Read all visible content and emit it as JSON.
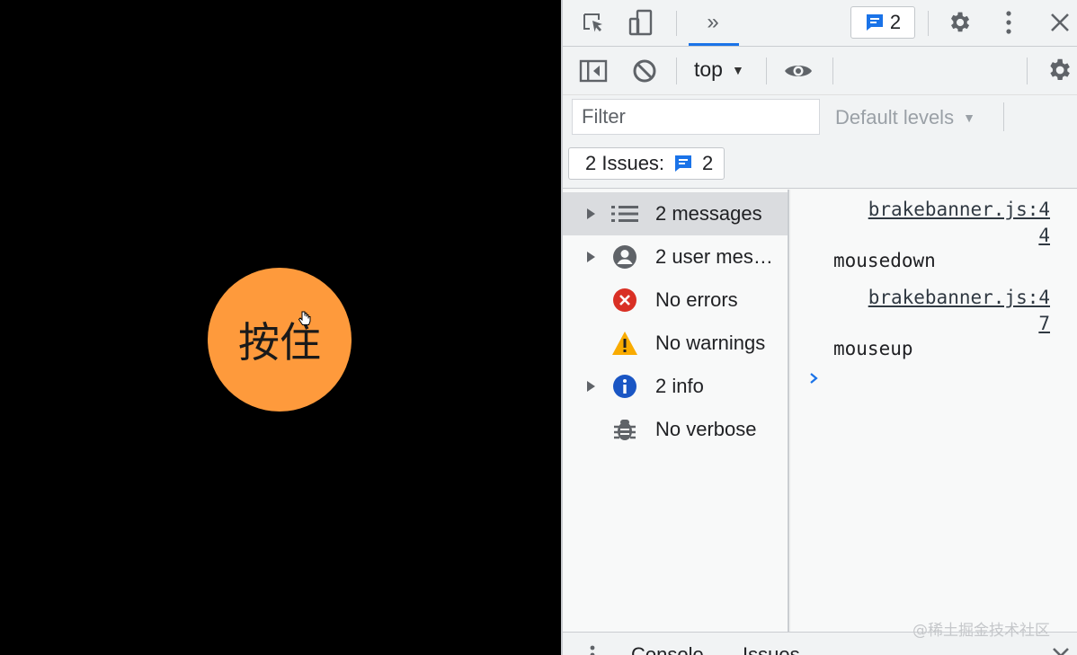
{
  "page": {
    "button_label": "按住"
  },
  "devtools": {
    "topbar": {
      "issues_count": "2"
    },
    "toolbar": {
      "context": "top"
    },
    "filter": {
      "placeholder": "Filter",
      "levels_label": "Default levels"
    },
    "issues_bar": {
      "label": "2 Issues:",
      "count": "2"
    },
    "sidebar": {
      "items": [
        {
          "label": "2 messages",
          "icon": "list-icon",
          "expandable": true,
          "selected": true
        },
        {
          "label": "2 user mes…",
          "icon": "user-icon",
          "expandable": true,
          "selected": false
        },
        {
          "label": "No errors",
          "icon": "error-icon",
          "expandable": false,
          "selected": false
        },
        {
          "label": "No warnings",
          "icon": "warning-icon",
          "expandable": false,
          "selected": false
        },
        {
          "label": "2 info",
          "icon": "info-icon",
          "expandable": true,
          "selected": false
        },
        {
          "label": "No verbose",
          "icon": "bug-icon",
          "expandable": false,
          "selected": false
        }
      ]
    },
    "console": {
      "entries": [
        {
          "source_line1": "brakebanner.js:4",
          "source_line2": "4",
          "message": "mousedown"
        },
        {
          "source_line1": "brakebanner.js:4",
          "source_line2": "7",
          "message": "mouseup"
        }
      ]
    },
    "drawer": {
      "tabs": [
        "Console",
        "Issues"
      ]
    }
  },
  "watermark": "@稀土掘金技术社区",
  "colors": {
    "accent": "#1a73e8",
    "button_orange": "#fe9a3c",
    "error_red": "#d93025",
    "warning_yellow": "#f9ab00",
    "info_blue": "#1a56c4"
  }
}
